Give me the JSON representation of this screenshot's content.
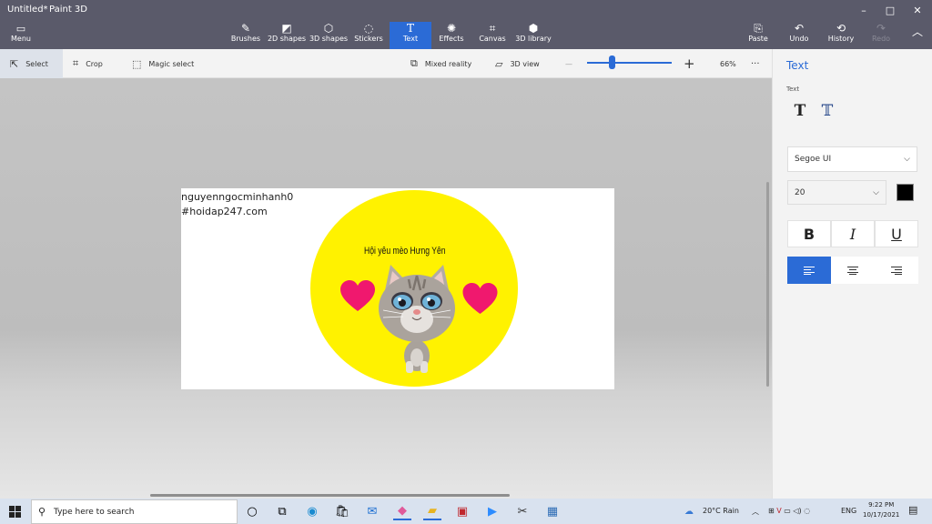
{
  "window": {
    "title": "Untitled*",
    "app_name": "Paint 3D",
    "controls": {
      "minimize": "–",
      "maximize": "□",
      "close": "✕"
    }
  },
  "ribbon": {
    "menu_label": "Menu",
    "tools": [
      {
        "label": "Brushes",
        "icon": "brush-icon",
        "glyph": "✎"
      },
      {
        "label": "2D shapes",
        "icon": "shapes-2d-icon",
        "glyph": "◩"
      },
      {
        "label": "3D shapes",
        "icon": "shapes-3d-icon",
        "glyph": "⬡"
      },
      {
        "label": "Stickers",
        "icon": "sticker-icon",
        "glyph": "◌"
      },
      {
        "label": "Text",
        "icon": "text-icon",
        "glyph": "T"
      },
      {
        "label": "Effects",
        "icon": "effects-icon",
        "glyph": "✺"
      },
      {
        "label": "Canvas",
        "icon": "canvas-icon",
        "glyph": "⌗"
      },
      {
        "label": "3D library",
        "icon": "library-3d-icon",
        "glyph": "⬢"
      }
    ],
    "active_tool": "Text",
    "right_tools": [
      {
        "label": "Paste",
        "icon": "paste-icon",
        "glyph": "⎘"
      },
      {
        "label": "Undo",
        "icon": "undo-icon",
        "glyph": "↶"
      },
      {
        "label": "History",
        "icon": "history-icon",
        "glyph": "⟲"
      },
      {
        "label": "Redo",
        "icon": "redo-icon",
        "glyph": "↷"
      }
    ]
  },
  "toolbar": {
    "select_label": "Select",
    "crop_label": "Crop",
    "magic_select_label": "Magic select",
    "mixed_reality_label": "Mixed reality",
    "view_3d_label": "3D view",
    "zoom_minus": "—",
    "zoom_plus": "+",
    "zoom_level": "66%",
    "zoom_fraction": 0.3,
    "more": "···"
  },
  "canvas": {
    "text_line_1": "nguyenngocminhanh0",
    "text_line_2": "#hoidap247.com",
    "caption": "Hội yêu mèo Hưng Yên",
    "colors": {
      "circle": "#fff200",
      "heart": "#f0186e"
    }
  },
  "panel": {
    "title": "Text",
    "subtitle": "Text",
    "font": "Segoe UI",
    "size": "20",
    "text_color": "#000000",
    "bold": "B",
    "italic": "I",
    "underline": "U"
  },
  "taskbar": {
    "search_placeholder": "Type here to search",
    "weather": "20°C  Rain",
    "language": "ENG",
    "time": "9:22 PM",
    "date": "10/17/2021"
  },
  "colors": {
    "accent": "#2b6bd6",
    "titlebar": "#5a5a6a"
  }
}
